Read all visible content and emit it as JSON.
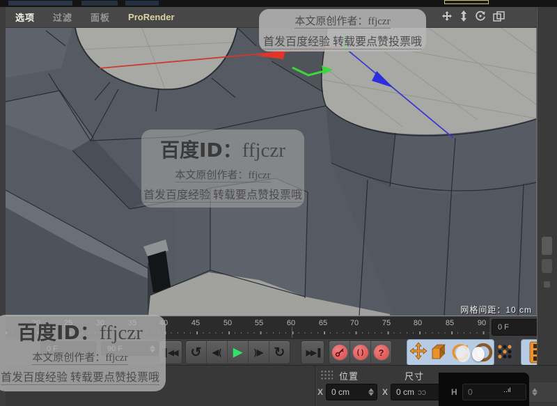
{
  "menu_bar": {
    "items": [
      {
        "label": "选项"
      },
      {
        "label": "过滤"
      },
      {
        "label": "面板"
      },
      {
        "label": "ProRender"
      }
    ],
    "view_controls": [
      "pan-icon",
      "dolly-icon",
      "rotate-icon",
      "maximize-view-icon"
    ]
  },
  "viewport": {
    "grid_label": "网格间距：10 cm",
    "axis_colors": {
      "x": "#e03528",
      "y": "#3ed43e",
      "z": "#2d2de0"
    }
  },
  "watermarks": {
    "top": {
      "line1": "本文原创作者：ffjczr",
      "line2": "首发百度经验 转载要点赞投票哦"
    },
    "center": {
      "title_prefix": "百度ID：",
      "title_id": "ffjczr",
      "line1": "本文原创作者：ffjczr",
      "line2": "首发百度经验 转载要点赞投票哦"
    },
    "bottom": {
      "title_prefix": "百度ID：",
      "title_id": "ffjczr",
      "line1": "本文原创作者：ffjczr",
      "line2": "首发百度经验 转载要点赞投票哦"
    }
  },
  "timeline": {
    "ticks": [
      "20",
      "25",
      "30",
      "35",
      "40",
      "45",
      "50",
      "55",
      "60",
      "65",
      "70",
      "75",
      "80",
      "85",
      "90"
    ],
    "current_frame_field": "0 F",
    "range_start_field": "0 F",
    "range_end_field": "90 F"
  },
  "transport": {
    "icons": [
      "goto-start-icon",
      "play-backwards-icon",
      "previous-frame-icon",
      "play-icon",
      "next-frame-icon",
      "play-forwards-icon",
      "goto-end-icon",
      "record-key-icon",
      "auto-key-icon",
      "question-icon"
    ],
    "glyphs": {
      "goto_start": "▌◀◀",
      "play_back": "↺",
      "prev_frame": "◀(",
      "play": "▶",
      "next_frame": ")▶",
      "play_fwd": "↻",
      "goto_end": "▶▶▐",
      "auto_key": "( )",
      "question": "?"
    }
  },
  "tools": {
    "accent_orange": "#e8912d",
    "selected_blue": "#b7cbe3",
    "icons": [
      "move-tool-icon",
      "scale-tool-icon",
      "rotate-tool-icon",
      "last-tool-icon",
      "grid-dots-icon",
      "film-strip-icon"
    ]
  },
  "coord_panel": {
    "headers": {
      "position": "位置",
      "size": "尺寸"
    },
    "fields": [
      {
        "axis": "X",
        "value": "0 cm"
      },
      {
        "axis": "X",
        "value": "0 cm"
      },
      {
        "axis": "H",
        "value": "0"
      }
    ]
  }
}
